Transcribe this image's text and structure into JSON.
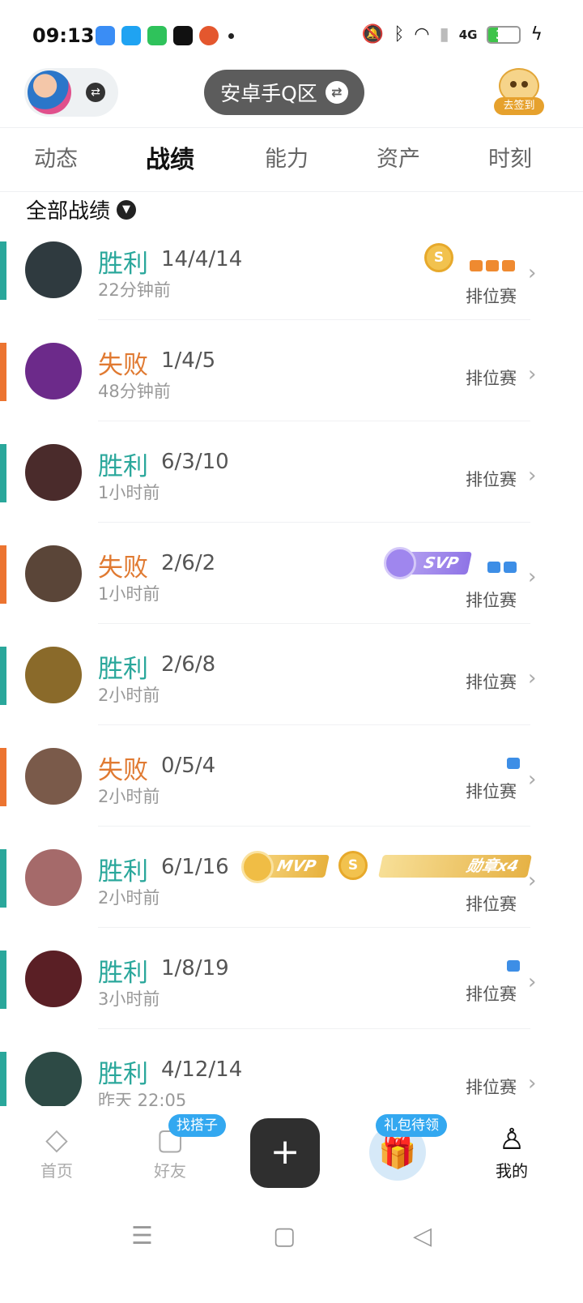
{
  "status_bar": {
    "time": "09:13",
    "app_icons": [
      {
        "name": "browser-icon",
        "color": "#3a8df5"
      },
      {
        "name": "qq-icon",
        "color": "#1fa3f2"
      },
      {
        "name": "phone-icon",
        "color": "#2fc25b"
      },
      {
        "name": "app-icon",
        "color": "#111111"
      },
      {
        "name": "pumpkin-icon",
        "color": "#e4572e"
      }
    ],
    "network": "4G",
    "battery_level": 30,
    "battery_text": "30",
    "battery_color": "#3ec34a"
  },
  "header": {
    "region": "安卓手Q区",
    "checkin_label": "去签到"
  },
  "tabs": [
    {
      "label": "动态",
      "active": false
    },
    {
      "label": "战绩",
      "active": true
    },
    {
      "label": "能力",
      "active": false
    },
    {
      "label": "资产",
      "active": false
    },
    {
      "label": "时刻",
      "active": false
    }
  ],
  "filter": {
    "label": "全部战绩"
  },
  "matches": [
    {
      "result": "胜利",
      "outcome": "win",
      "kda": "14/4/14",
      "time": "22分钟前",
      "mode": "排位赛",
      "hero_color": "#2f3a3f"
    },
    {
      "result": "失败",
      "outcome": "loss",
      "kda": "1/4/5",
      "time": "48分钟前",
      "mode": "排位赛",
      "hero_color": "#6c2a8a"
    },
    {
      "result": "胜利",
      "outcome": "win",
      "kda": "6/3/10",
      "time": "1小时前",
      "mode": "排位赛",
      "hero_color": "#4a2b2b"
    },
    {
      "result": "失败",
      "outcome": "loss",
      "kda": "2/6/2",
      "time": "1小时前",
      "mode": "排位赛",
      "hero_color": "#5a4538",
      "badge": "SVP"
    },
    {
      "result": "胜利",
      "outcome": "win",
      "kda": "2/6/8",
      "time": "2小时前",
      "mode": "排位赛",
      "hero_color": "#8a6a2a"
    },
    {
      "result": "失败",
      "outcome": "loss",
      "kda": "0/5/4",
      "time": "2小时前",
      "mode": "排位赛",
      "hero_color": "#7a5a4a"
    },
    {
      "result": "胜利",
      "outcome": "win",
      "kda": "6/1/16",
      "time": "2小时前",
      "mode": "排位赛",
      "hero_color": "#a56a6a",
      "badge": "MVP",
      "medal": "勋章x4"
    },
    {
      "result": "胜利",
      "outcome": "win",
      "kda": "1/8/19",
      "time": "3小时前",
      "mode": "排位赛",
      "hero_color": "#5a1f25"
    },
    {
      "result": "胜利",
      "outcome": "win",
      "kda": "4/12/14",
      "time": "昨天 22:05",
      "mode": "排位赛",
      "hero_color": "#2d4a45"
    }
  ],
  "bottom_nav": {
    "home": "首页",
    "friends": "好友",
    "friends_badge": "找搭子",
    "gift_badge": "礼包待领",
    "me": "我的"
  }
}
